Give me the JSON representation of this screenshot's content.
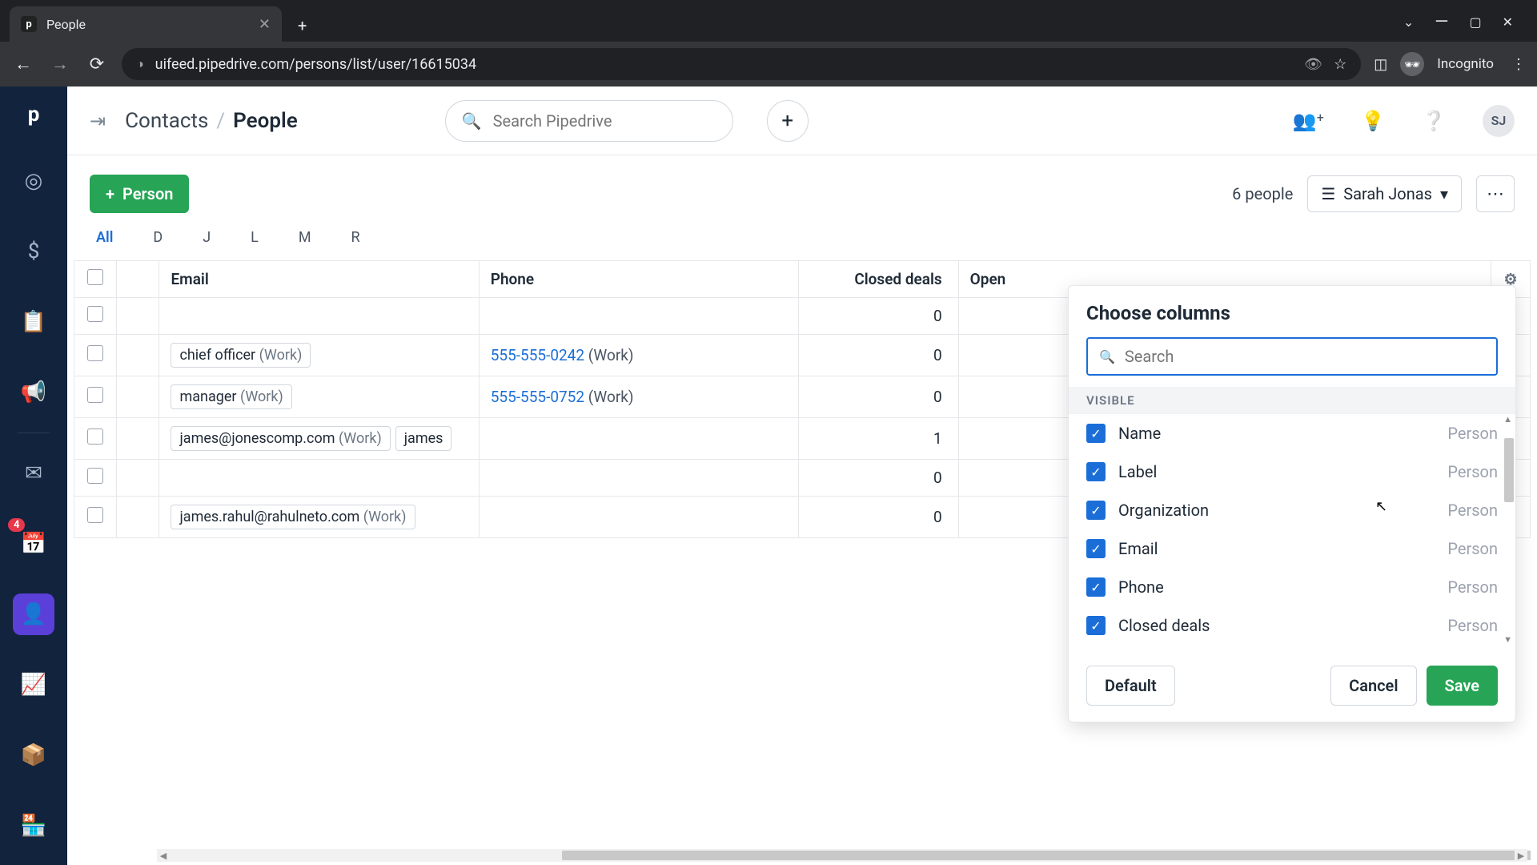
{
  "browser": {
    "tab_title": "People",
    "url": "uifeed.pipedrive.com/persons/list/user/16615034",
    "incognito_label": "Incognito"
  },
  "sidebar": {
    "badge": "4"
  },
  "header": {
    "breadcrumb_section": "Contacts",
    "breadcrumb_separator": "/",
    "breadcrumb_page": "People",
    "search_placeholder": "Search Pipedrive",
    "avatar_initials": "SJ"
  },
  "toolbar": {
    "add_label": "Person",
    "count_text": "6 people",
    "filter_label": "Sarah Jonas"
  },
  "alpha": [
    "All",
    "D",
    "J",
    "L",
    "M",
    "R"
  ],
  "table": {
    "headers": {
      "email": "Email",
      "phone": "Phone",
      "closed": "Closed deals",
      "open": "Open"
    },
    "rows": [
      {
        "email_chips": [],
        "phone": "",
        "phone_suffix": "",
        "closed": "0"
      },
      {
        "email_chips": [
          {
            "text": "chief officer",
            "sub": "(Work)"
          }
        ],
        "phone": "555-555-0242",
        "phone_suffix": "(Work)",
        "closed": "0"
      },
      {
        "email_chips": [
          {
            "text": "manager",
            "sub": "(Work)"
          }
        ],
        "phone": "555-555-0752",
        "phone_suffix": "(Work)",
        "closed": "0"
      },
      {
        "email_chips": [
          {
            "text": "james@jonescomp.com",
            "sub": "(Work)"
          },
          {
            "text": "james",
            "sub": ""
          }
        ],
        "phone": "",
        "phone_suffix": "",
        "closed": "1"
      },
      {
        "email_chips": [],
        "phone": "",
        "phone_suffix": "",
        "closed": "0"
      },
      {
        "email_chips": [
          {
            "text": "james.rahul@rahulneto.com",
            "sub": "(Work)"
          }
        ],
        "phone": "",
        "phone_suffix": "",
        "closed": "0"
      }
    ]
  },
  "popover": {
    "title": "Choose columns",
    "search_placeholder": "Search",
    "section": "VISIBLE",
    "category_label": "Person",
    "items": [
      "Name",
      "Label",
      "Organization",
      "Email",
      "Phone",
      "Closed deals"
    ],
    "default_btn": "Default",
    "cancel_btn": "Cancel",
    "save_btn": "Save"
  }
}
